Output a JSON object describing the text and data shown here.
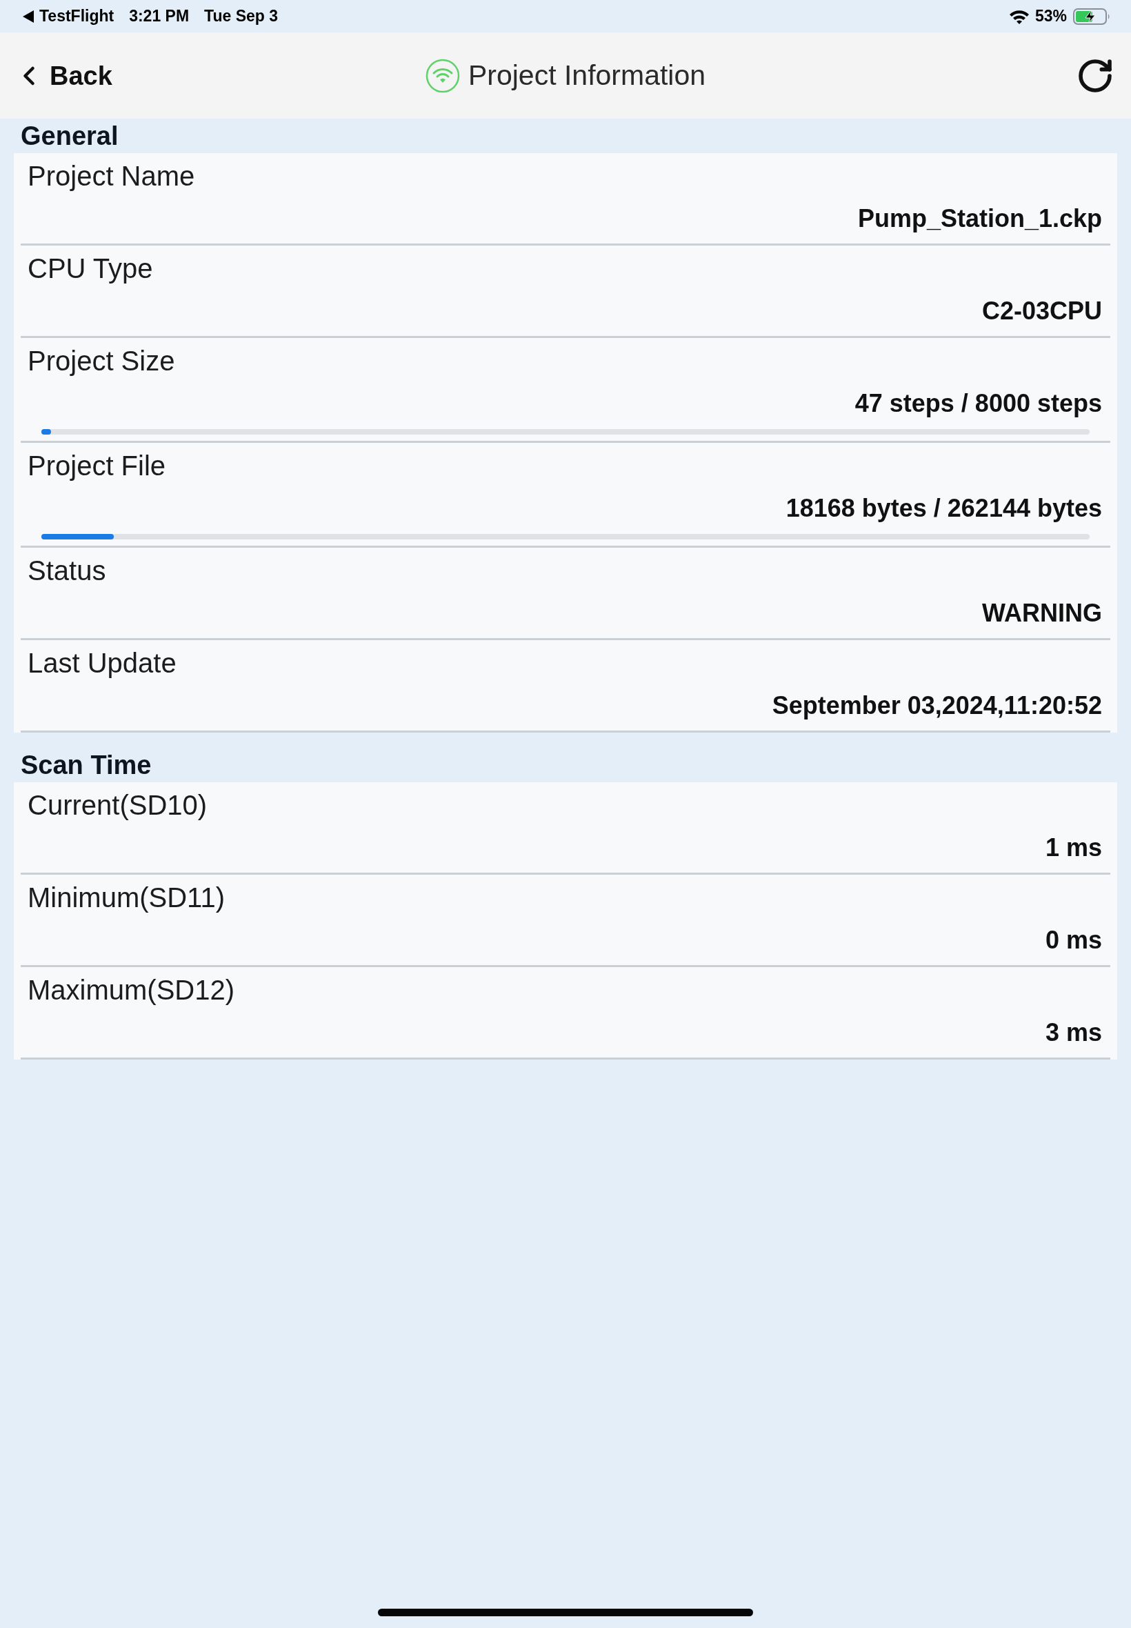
{
  "status_bar": {
    "back_app": "TestFlight",
    "time": "3:21 PM",
    "date": "Tue Sep 3",
    "battery": "53%"
  },
  "nav_bar": {
    "back": "Back",
    "title": "Project Information"
  },
  "sections": [
    {
      "title": "General",
      "rows": [
        {
          "kind": "text",
          "label": "Project Name",
          "value": "Pump_Station_1.ckp"
        },
        {
          "kind": "text",
          "label": "CPU Type",
          "value": "C2-03CPU"
        },
        {
          "kind": "progress",
          "label": "Project Size",
          "value": "47 steps / 8000 steps",
          "level": 0.006
        },
        {
          "kind": "progress",
          "label": "Project File",
          "value": "18168 bytes / 262144 bytes",
          "level": 0.069
        },
        {
          "kind": "text",
          "label": "Status",
          "value": "WARNING"
        },
        {
          "kind": "text",
          "label": "Last Update",
          "value": "September 03,2024,11:20:52"
        }
      ]
    },
    {
      "title": "Scan Time",
      "rows": [
        {
          "kind": "text",
          "label": "Current(SD10)",
          "value": "1 ms"
        },
        {
          "kind": "text",
          "label": "Minimum(SD11)",
          "value": "0 ms"
        },
        {
          "kind": "text",
          "label": "Maximum(SD12)",
          "value": "3 ms"
        }
      ]
    }
  ]
}
